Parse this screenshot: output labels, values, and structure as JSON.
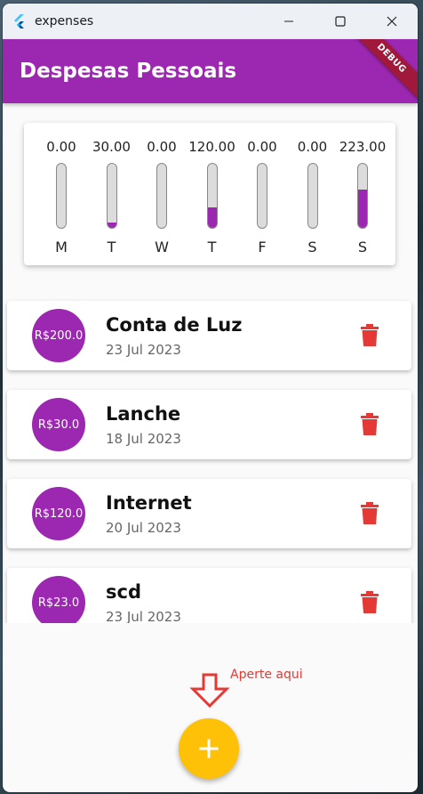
{
  "window": {
    "title": "expenses"
  },
  "appbar": {
    "title": "Despesas Pessoais",
    "debug_label": "DEBUG"
  },
  "colors": {
    "primary": "#9c27b0",
    "accent": "#ffc107",
    "delete": "#e53935",
    "hint": "#e53935"
  },
  "chart_data": {
    "type": "bar",
    "categories": [
      "M",
      "T",
      "W",
      "T",
      "F",
      "S",
      "S"
    ],
    "values": [
      0.0,
      30.0,
      0.0,
      120.0,
      0.0,
      0.0,
      223.0
    ],
    "value_labels": [
      "0.00",
      "30.00",
      "0.00",
      "120.00",
      "0.00",
      "0.00",
      "223.00"
    ],
    "fill_fraction": [
      0.0,
      0.0811,
      0.0,
      0.3243,
      0.0,
      0.0,
      0.6027
    ]
  },
  "transactions": [
    {
      "value": "R$200.0",
      "title": "Conta de Luz",
      "date": "23 Jul 2023"
    },
    {
      "value": "R$30.0",
      "title": "Lanche",
      "date": "18 Jul 2023"
    },
    {
      "value": "R$120.0",
      "title": "Internet",
      "date": "20 Jul 2023"
    },
    {
      "value": "R$23.0",
      "title": "scd",
      "date": "23 Jul 2023"
    }
  ],
  "hint": {
    "text": "Aperte aqui",
    "icon": "arrow-down-outline-icon"
  },
  "fab": {
    "icon": "plus-icon"
  }
}
